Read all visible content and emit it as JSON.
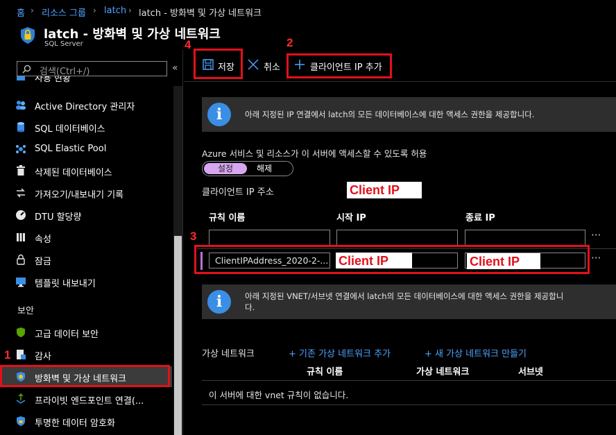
{
  "breadcrumb": {
    "items": [
      "홈",
      "리소스 그룹",
      "latch",
      "latch - 방화벽 및 가상 네트워크"
    ]
  },
  "header": {
    "title": "latch - 방화벽 및 가상 네트워크",
    "subtitle": "SQL Server"
  },
  "sidebar": {
    "search_placeholder": "검색(Ctrl+/)",
    "items": [
      {
        "label": "사용 현황",
        "icon": "partial-icon"
      },
      {
        "label": "Active Directory 관리자",
        "icon": "people-icon"
      },
      {
        "label": "SQL 데이터베이스",
        "icon": "database-icon"
      },
      {
        "label": "SQL Elastic Pool",
        "icon": "elastic-pool-icon"
      },
      {
        "label": "삭제된 데이터베이스",
        "icon": "trash-icon"
      },
      {
        "label": "가져오기/내보내기 기록",
        "icon": "import-export-icon"
      },
      {
        "label": "DTU 할당량",
        "icon": "gauge-icon"
      },
      {
        "label": "속성",
        "icon": "properties-icon"
      },
      {
        "label": "잠금",
        "icon": "lock-icon"
      },
      {
        "label": "템플릿 내보내기",
        "icon": "template-icon"
      },
      {
        "label": "고급 데이터 보안",
        "icon": "shield-green-icon"
      },
      {
        "label": "감사",
        "icon": "audit-icon"
      },
      {
        "label": "방화벽 및 가상 네트워크",
        "icon": "firewall-icon"
      },
      {
        "label": "프라이빗 엔드포인트 연결(...",
        "icon": "endpoint-icon"
      },
      {
        "label": "투명한 데이터 암호화",
        "icon": "encryption-icon"
      }
    ],
    "section_security": "보안"
  },
  "toolbar": {
    "save": "저장",
    "cancel": "취소",
    "add_client_ip": "클라이언트 IP 추가"
  },
  "info1": "아래 지정된 IP 연결에서 latch의 모든 데이터베이스에 대한 액세스 권한을 제공합니다.",
  "allow_azure": {
    "label": "Azure 서비스 및 리소스가 이 서버에 액세스할 수 있도록 허용",
    "on": "설정",
    "off": "해제"
  },
  "client_ip_label": "클라이언트 IP 주소",
  "client_ip_value": "Client IP",
  "rules_table": {
    "columns": [
      "규칙 이름",
      "시작 IP",
      "종료 IP"
    ],
    "rows": [
      {
        "name": "",
        "start": "",
        "end": ""
      },
      {
        "name": "ClientIPAddress_2020-2-...",
        "start": "Client IP",
        "end": "Client IP"
      }
    ]
  },
  "info2_line1": "아래 지정된 VNET/서브넷 연결에서 latch의 모든 데이터베이스에 대한 액세스 권한을 제공합니",
  "info2_line2": "다.",
  "vnet": {
    "label": "가상 네트워크",
    "add_existing": "+ 기존 가상 네트워크 추가",
    "create_new": "+ 새 가상 네트워크 만들기",
    "columns": [
      "규칙 이름",
      "가상 네트워크",
      "서브넷"
    ],
    "empty": "이 서버에 대한 vnet 규칙이 없습니다."
  },
  "annotations": [
    "1",
    "2",
    "3",
    "4"
  ],
  "colors": {
    "accent": "#4fa3ff",
    "annotation_red": "#e3101b",
    "toggle_on": "#d7a6f0"
  }
}
